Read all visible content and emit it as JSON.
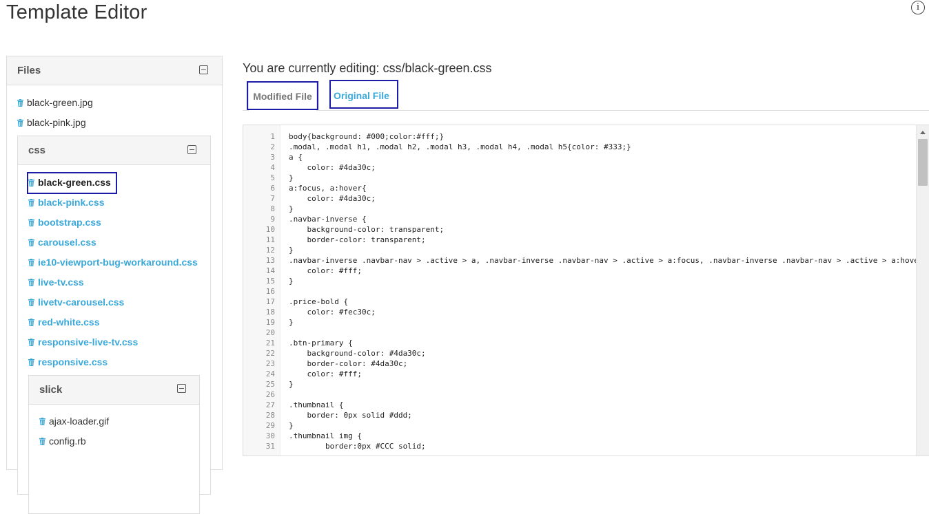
{
  "header": {
    "title": "Template Editor",
    "info_icon": "info-icon"
  },
  "files_panel": {
    "title": "Files",
    "root_files": [
      "black-green.jpg",
      "black-pink.jpg"
    ],
    "css_folder": {
      "title": "css",
      "files": [
        "black-green.css",
        "black-pink.css",
        "bootstrap.css",
        "carousel.css",
        "ie10-viewport-bug-workaround.css",
        "live-tv.css",
        "livetv-carousel.css",
        "red-white.css",
        "responsive-live-tv.css",
        "responsive.css"
      ],
      "active_file": "black-green.css"
    },
    "slick_folder": {
      "title": "slick",
      "files": [
        "ajax-loader.gif",
        "config.rb"
      ]
    }
  },
  "editor": {
    "editing_label": "You are currently editing: css/black-green.css",
    "tabs": [
      {
        "label": "Modified File",
        "active": true
      },
      {
        "label": "Original File",
        "active": false
      }
    ],
    "lines": [
      "body{background: #000;color:#fff;}",
      ".modal, .modal h1, .modal h2, .modal h3, .modal h4, .modal h5{color: #333;}",
      "a {",
      "    color: #4da30c;",
      "}",
      "a:focus, a:hover{",
      "    color: #4da30c;",
      "}",
      ".navbar-inverse {",
      "    background-color: transparent;",
      "    border-color: transparent;",
      "}",
      ".navbar-inverse .navbar-nav > .active > a, .navbar-inverse .navbar-nav > .active > a:focus, .navbar-inverse .navbar-nav > .active > a:hover{",
      "    color: #fff;",
      "}",
      "",
      ".price-bold {",
      "    color: #fec30c;",
      "}",
      "",
      ".btn-primary {",
      "    background-color: #4da30c;",
      "    border-color: #4da30c;",
      "    color: #fff;",
      "}",
      "",
      ".thumbnail {",
      "    border: 0px solid #ddd;",
      "}",
      ".thumbnail img {",
      "        border:0px #CCC solid;"
    ]
  },
  "colors": {
    "link": "#3aa8d8",
    "highlight_box": "#1b1ba8"
  }
}
